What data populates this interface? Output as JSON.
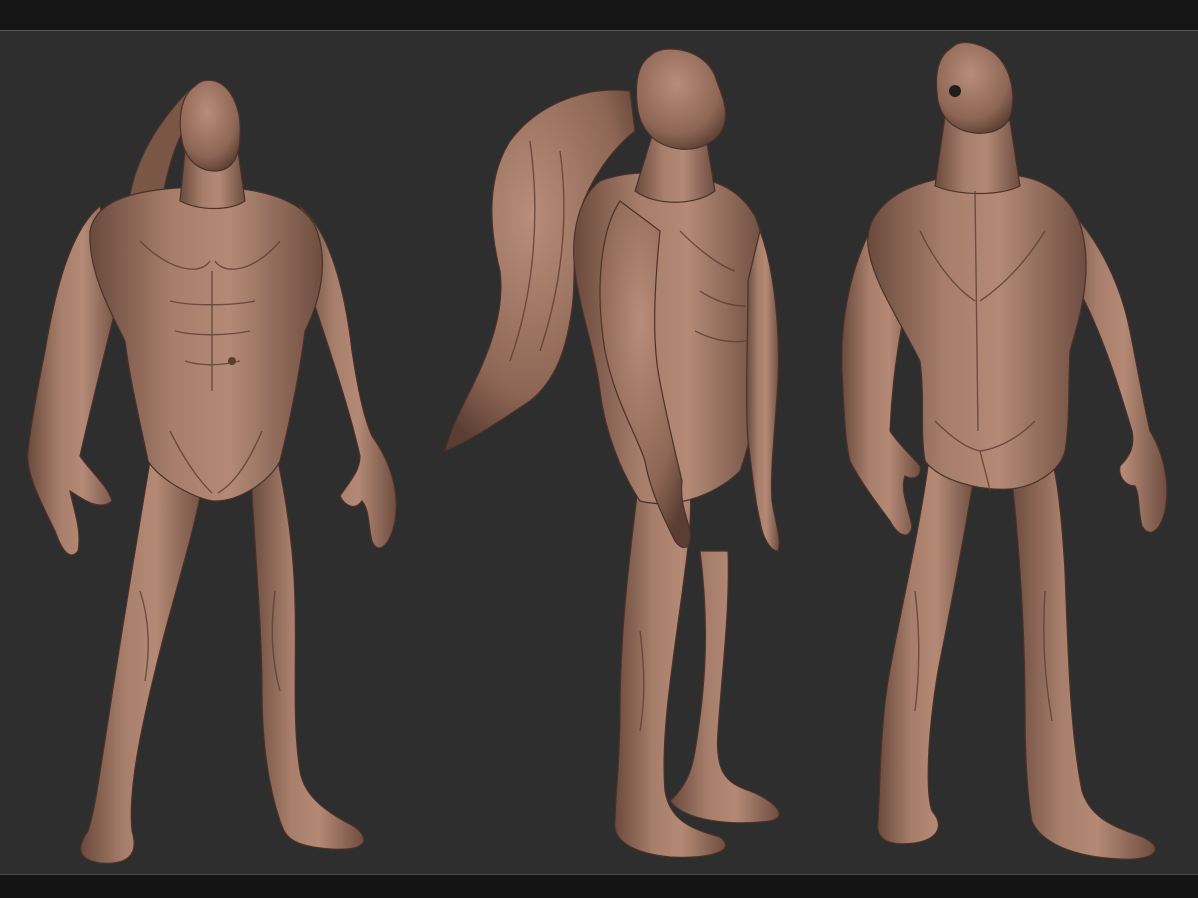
{
  "colors": {
    "background": "#2e2e2e",
    "frame_bars": "#151515",
    "divider": "#5a5a5a",
    "clay_light": "#b48a76",
    "clay_mid": "#8e6655",
    "clay_dark": "#5b3e33"
  },
  "views": [
    {
      "view": "front"
    },
    {
      "view": "side"
    },
    {
      "view": "back"
    }
  ]
}
